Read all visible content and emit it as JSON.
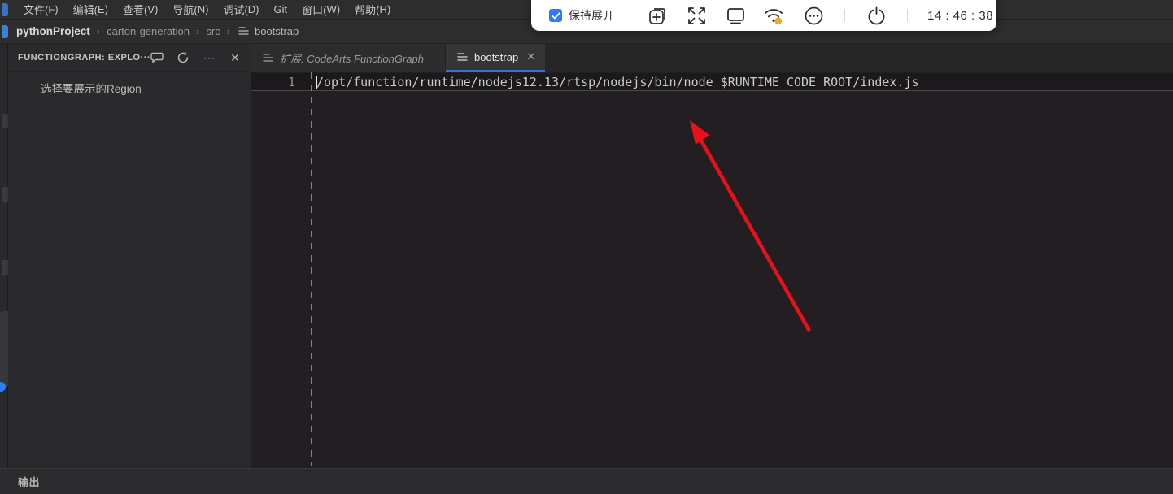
{
  "menu": {
    "items": [
      {
        "pre": "文件(",
        "key": "F",
        "post": ")"
      },
      {
        "pre": "编辑(",
        "key": "E",
        "post": ")"
      },
      {
        "pre": "查看(",
        "key": "V",
        "post": ")"
      },
      {
        "pre": "导航(",
        "key": "N",
        "post": ")"
      },
      {
        "pre": "调试(",
        "key": "D",
        "post": ")"
      },
      {
        "pre": "",
        "key": "G",
        "post": "it"
      },
      {
        "pre": "窗口(",
        "key": "W",
        "post": ")"
      },
      {
        "pre": "帮助(",
        "key": "H",
        "post": ")"
      }
    ]
  },
  "breadcrumb": {
    "project": "pythonProject",
    "sep": "›",
    "folder1": "carton-generation",
    "folder2": "src",
    "file": "bootstrap"
  },
  "toolbar": {
    "keep_open_label": "保持展开",
    "time": "14 : 46 : 38",
    "icons": [
      "checkbox-checked",
      "new-window",
      "fullscreen",
      "display",
      "wifi-status",
      "more-options",
      "power"
    ]
  },
  "sidebar": {
    "title": "FUNCTIONGRAPH: EXPLO···",
    "more_glyph": "⋯",
    "close_glyph": "✕",
    "content_text": "选择要展示的Region",
    "icons": [
      "comment",
      "refresh",
      "more",
      "close"
    ]
  },
  "tabs": {
    "extension": {
      "label": "扩展: CodeArts FunctionGraph"
    },
    "bootstrap": {
      "label": "bootstrap",
      "close_glyph": "✕"
    }
  },
  "editor": {
    "line_number": "1",
    "code": "/opt/function/runtime/nodejs12.13/rtsp/nodejs/bin/node $RUNTIME_CODE_ROOT/index.js"
  },
  "panel": {
    "output_label": "输出"
  },
  "colors": {
    "accent_blue": "#2e7bf6",
    "tab_underline": "#3178d6",
    "arrow_red": "#e8111a",
    "wifi_status_dot": "#f5a623",
    "toolbar_bg": "#ffffff",
    "editor_bg": "#221e22",
    "sidebar_bg": "#2a292b"
  }
}
